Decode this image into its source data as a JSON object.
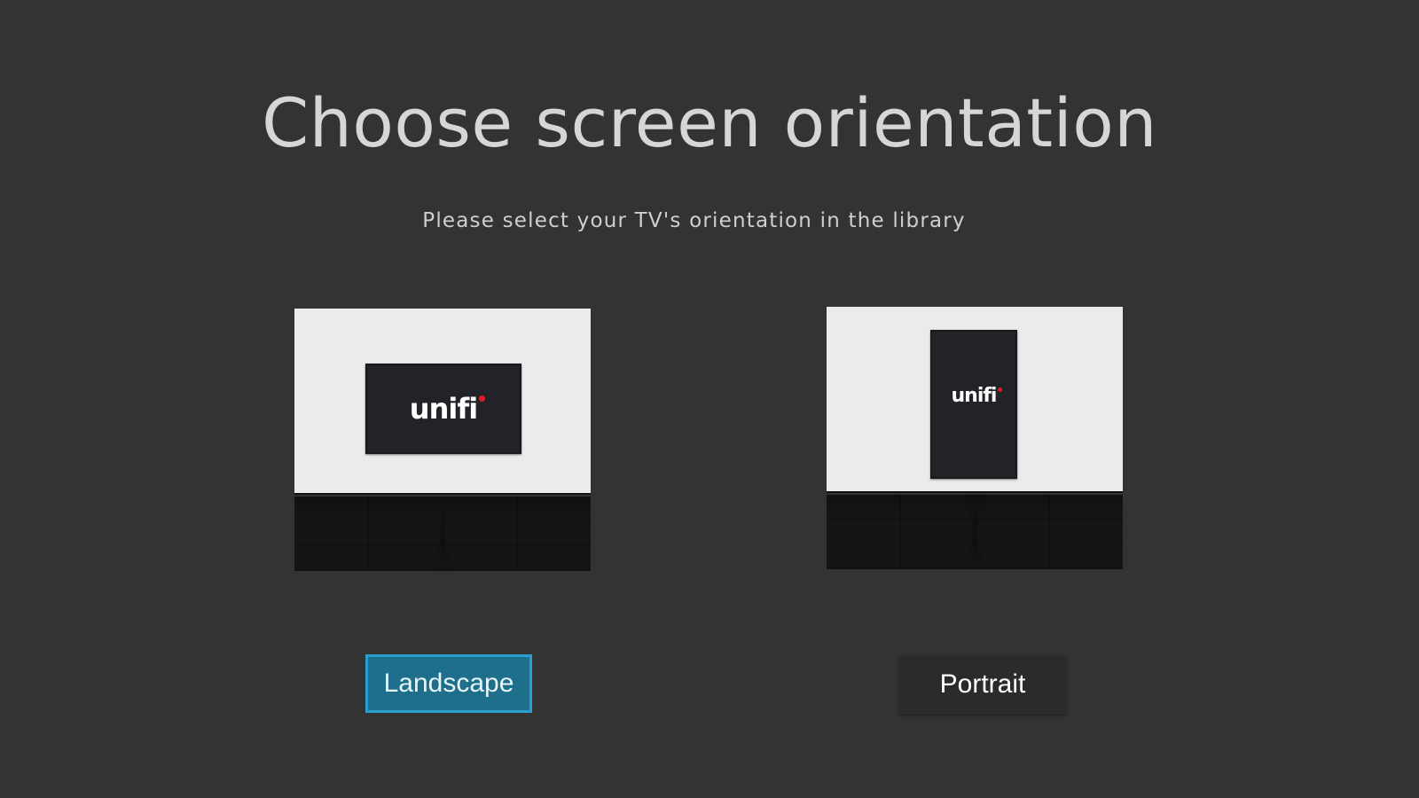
{
  "header": {
    "title": "Choose screen orientation",
    "subtitle": "Please select your TV's orientation in the library"
  },
  "options": {
    "landscape": {
      "logo_text": "unifi",
      "button_label": "Landscape",
      "selected": true
    },
    "portrait": {
      "logo_text": "unifi",
      "button_label": "Portrait",
      "selected": false
    }
  },
  "colors": {
    "background": "#333333",
    "selected_button": "#1d6f8c",
    "selected_border": "#2a9fcf",
    "logo_dot": "#e51b23"
  }
}
